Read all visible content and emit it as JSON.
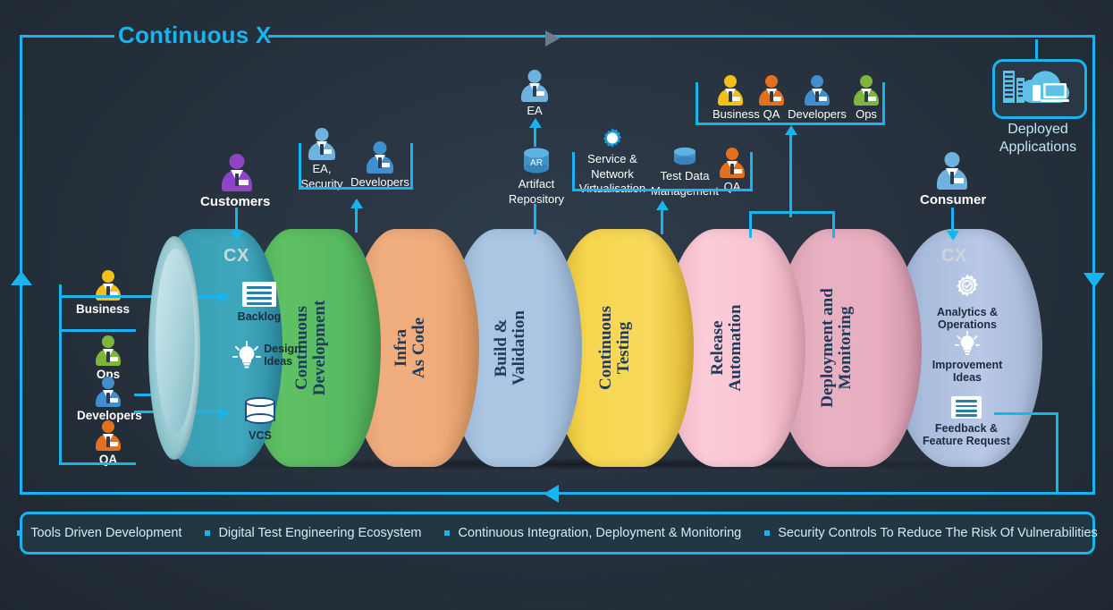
{
  "title": "Continuous X",
  "colors": {
    "accent": "#18b4ef",
    "background": "#26313d",
    "deployed_label": "#bfe8f5"
  },
  "deployed": {
    "icon": "cloud-devices-icon",
    "label_line1": "Deployed",
    "label_line2": "Applications"
  },
  "top_nodes": {
    "customers": {
      "label": "Customers",
      "icon": "person-icon",
      "color": "#8e44c6"
    },
    "ea_security": {
      "label_line1": "EA,",
      "label_line2": "Security",
      "icon": "person-icon",
      "color": "#6eb3e0"
    },
    "developers": {
      "label": "Developers",
      "icon": "person-icon",
      "color": "#3f8fce"
    },
    "ea": {
      "label": "EA",
      "icon": "person-icon",
      "color": "#6eb3e0"
    },
    "artifact_repository": {
      "badge": "AR",
      "label_line1": "Artifact",
      "label_line2": "Repository",
      "icon": "database-icon"
    },
    "service_network": {
      "label_line1": "Service &",
      "label_line2": "Network",
      "label_line3": "Virtualisation",
      "icon": "gear-icon"
    },
    "test_data": {
      "label_line1": "Test Data",
      "label_line2": "Management",
      "icon": "database-icon"
    },
    "qa": {
      "label": "QA",
      "icon": "person-icon",
      "color": "#e2701f"
    },
    "team": [
      {
        "label": "Business",
        "icon": "person-icon",
        "color": "#f2c018"
      },
      {
        "label": "QA",
        "icon": "person-icon",
        "color": "#e2701f"
      },
      {
        "label": "Developers",
        "icon": "person-icon",
        "color": "#3f8fce"
      },
      {
        "label": "Ops",
        "icon": "person-icon",
        "color": "#7eb53c"
      }
    ],
    "consumer": {
      "label": "Consumer",
      "icon": "person-icon",
      "color": "#6eb3e0"
    }
  },
  "left_nodes": {
    "business": {
      "label": "Business",
      "icon": "person-icon",
      "color": "#f2c018"
    },
    "group": [
      {
        "label": "Ops",
        "icon": "person-icon",
        "color": "#7eb53c"
      },
      {
        "label": "Developers",
        "icon": "person-icon",
        "color": "#3f8fce"
      },
      {
        "label": "QA",
        "icon": "person-icon",
        "color": "#e2701f"
      }
    ]
  },
  "pipeline": {
    "start_cx_tag": "CX",
    "end_cx_tag": "CX",
    "segments": [
      {
        "name": "cx-start",
        "label": "",
        "color": "#3a9cb3"
      },
      {
        "name": "continuous-development",
        "label": "Continuous\nDevelopment",
        "color": "#5cbd5f"
      },
      {
        "name": "infra-as-code",
        "label": "Infra\nAs Code",
        "color": "#eda777"
      },
      {
        "name": "build-validation",
        "label": "Build &\nValidation",
        "color": "#a8c6e2"
      },
      {
        "name": "continuous-testing",
        "label": "Continuous\nTesting",
        "color": "#f6d44a"
      },
      {
        "name": "release-automation",
        "label": "Release\nAutomation",
        "color": "#f6bcc9"
      },
      {
        "name": "deployment-and-monitoring",
        "label": "Deployment and\nMonitoring",
        "color": "#e4a8bb"
      },
      {
        "name": "cx-end",
        "label": "",
        "color": "#9fb4d9"
      }
    ],
    "start_items": [
      {
        "label": "Backlog",
        "icon": "document-icon"
      },
      {
        "label_line1": "Design",
        "label_line2": "Ideas",
        "icon": "lightbulb-icon"
      },
      {
        "label": "VCS",
        "icon": "database-icon"
      }
    ],
    "end_items": [
      {
        "label_line1": "Analytics &",
        "label_line2": "Operations",
        "icon": "gear-check-icon"
      },
      {
        "label_line1": "Improvement",
        "label_line2": "Ideas",
        "icon": "lightbulb-icon"
      },
      {
        "label_line1": "Feedback &",
        "label_line2": "Feature Request",
        "icon": "document-icon"
      }
    ]
  },
  "bullets": [
    "Tools Driven Development",
    "Digital Test Engineering Ecosystem",
    "Continuous Integration, Deployment & Monitoring",
    "Security Controls To Reduce The Risk Of Vulnerabilities"
  ]
}
